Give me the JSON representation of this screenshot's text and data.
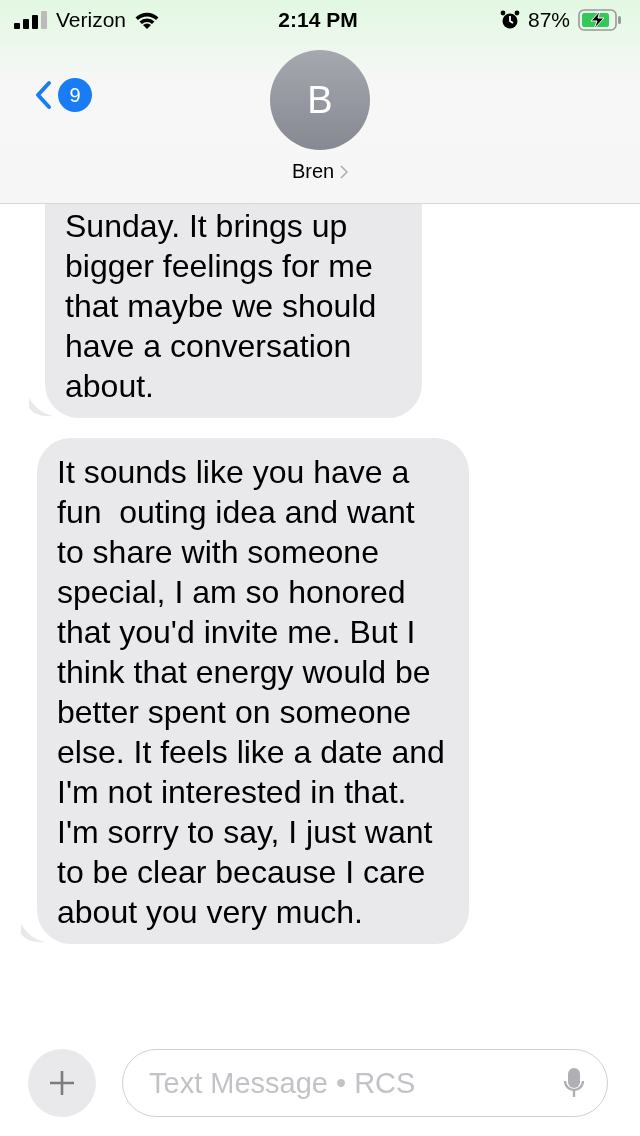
{
  "status_bar": {
    "carrier": "Verizon",
    "time": "2:14 PM",
    "battery": "87%"
  },
  "header": {
    "back_count": "9",
    "avatar_initial": "B",
    "contact_name": "Bren"
  },
  "messages": [
    {
      "text": "Sunday. It brings up bigger feelings for me that maybe we should have a conversation about.",
      "cut_top": true
    },
    {
      "text": "It sounds like you have a fun  outing idea and want to share with someone special, I am so honored that you'd invite me. But I think that energy would be better spent on someone else. It feels like a date and I'm not interested in that. I'm sorry to say, I just want to be clear because I care about you very much.",
      "cut_top": false
    }
  ],
  "composer": {
    "placeholder": "Text Message • RCS"
  }
}
